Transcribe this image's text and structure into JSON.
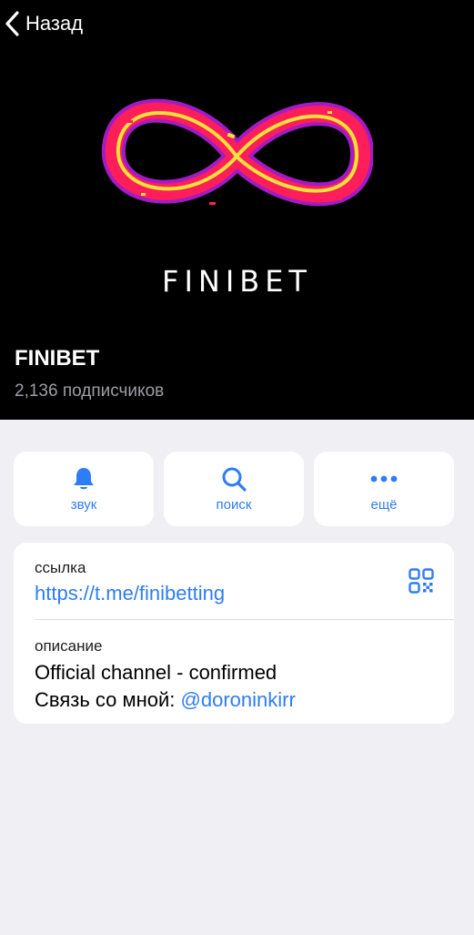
{
  "nav": {
    "back_label": "Назад",
    "back_icon": "chevron-left-icon"
  },
  "header": {
    "logo_text": "FINIBET",
    "channel_name": "FINIBET",
    "subscribers": "2,136 подписчиков",
    "logo_colors": {
      "outer": "#ff1e5a",
      "glow": "#c020e8",
      "inner": "#f2e23a"
    }
  },
  "actions": [
    {
      "label": "звук",
      "icon": "bell-icon"
    },
    {
      "label": "поиск",
      "icon": "search-icon"
    },
    {
      "label": "ещё",
      "icon": "more-icon"
    }
  ],
  "info": {
    "link_label": "ссылка",
    "link_value": "https://t.me/finibetting",
    "qr_icon": "qr-code-icon",
    "description_label": "описание",
    "description_line1": "Official channel - confirmed",
    "description_line2_prefix": "Связь со мной: ",
    "description_mention": "@doroninkirr"
  },
  "colors": {
    "accent": "#2e7cf6",
    "background": "#efeff4",
    "header": "#000000"
  }
}
